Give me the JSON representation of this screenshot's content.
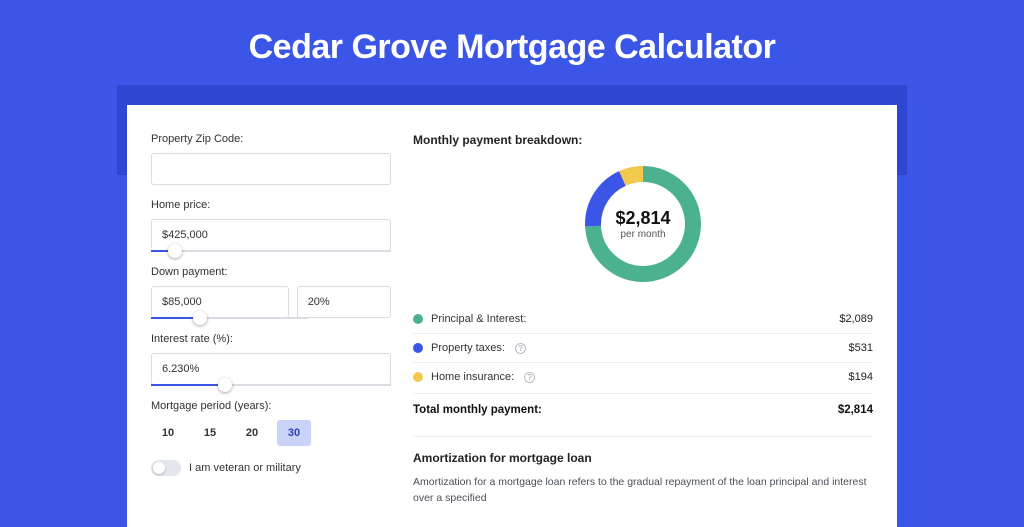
{
  "title": "Cedar Grove Mortgage Calculator",
  "form": {
    "zip_label": "Property Zip Code:",
    "zip_value": "",
    "homeprice_label": "Home price:",
    "homeprice_value": "$425,000",
    "homeprice_slider_pct": 10,
    "down_label": "Down payment:",
    "down_value": "$85,000",
    "down_pct_value": "20%",
    "down_slider_pct": 20,
    "rate_label": "Interest rate (%):",
    "rate_value": "6.230%",
    "rate_slider_pct": 31,
    "period_label": "Mortgage period (years):",
    "period_options": [
      "10",
      "15",
      "20",
      "30"
    ],
    "period_selected": "30",
    "vet_label": "I am veteran or military",
    "vet_on": false
  },
  "breakdown": {
    "title": "Monthly payment breakdown:",
    "center_value": "$2,814",
    "center_sub": "per month",
    "items": [
      {
        "label": "Principal & Interest:",
        "amount": "$2,089",
        "color": "#4bb18f",
        "pct": 74.2,
        "info": false
      },
      {
        "label": "Property taxes:",
        "amount": "$531",
        "color": "#3b55e6",
        "pct": 18.9,
        "info": true
      },
      {
        "label": "Home insurance:",
        "amount": "$194",
        "color": "#f2c94c",
        "pct": 6.9,
        "info": true
      }
    ],
    "total_label": "Total monthly payment:",
    "total_amount": "$2,814"
  },
  "amort": {
    "title": "Amortization for mortgage loan",
    "text": "Amortization for a mortgage loan refers to the gradual repayment of the loan principal and interest over a specified"
  },
  "chart_data": {
    "type": "pie",
    "title": "Monthly payment breakdown",
    "series": [
      {
        "name": "Principal & Interest",
        "value": 2089,
        "color": "#4bb18f"
      },
      {
        "name": "Property taxes",
        "value": 531,
        "color": "#3b55e6"
      },
      {
        "name": "Home insurance",
        "value": 194,
        "color": "#f2c94c"
      }
    ],
    "total": 2814,
    "unit": "USD per month"
  }
}
